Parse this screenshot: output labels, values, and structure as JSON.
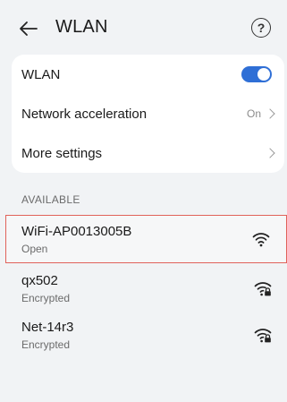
{
  "header": {
    "title": "WLAN",
    "back_icon": "arrow-left-icon",
    "help_icon": "question-circle-icon",
    "help_glyph": "?"
  },
  "settings": {
    "wlan_label": "WLAN",
    "wlan_enabled": true,
    "accent": "#2f6fd6",
    "acceleration_label": "Network acceleration",
    "acceleration_value": "On",
    "more_label": "More settings"
  },
  "available": {
    "section_title": "AVAILABLE",
    "networks": [
      {
        "name": "WiFi-AP0013005B",
        "status": "Open",
        "secured": false,
        "highlighted": true
      },
      {
        "name": "qx502",
        "status": "Encrypted",
        "secured": true,
        "highlighted": false
      },
      {
        "name": "Net-14r3",
        "status": "Encrypted",
        "secured": true,
        "highlighted": false
      }
    ],
    "highlight_color": "#e0625a"
  }
}
